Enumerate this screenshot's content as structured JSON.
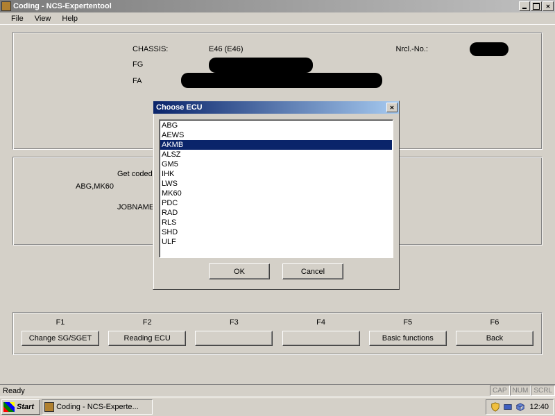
{
  "window": {
    "title": "Coding - NCS-Expertentool"
  },
  "menu": {
    "file": "File",
    "view": "View",
    "help": "Help"
  },
  "info": {
    "chassis_label": "CHASSIS:",
    "chassis_value": "E46 (E46)",
    "nrcl_label": "Nrcl.-No.:",
    "fg_label": "FG",
    "fa_label": "FA"
  },
  "coded": {
    "get_coded_label": "Get coded:",
    "coded_list": "ABG,MK60",
    "jobname_label": "JOBNAME"
  },
  "fkeys": {
    "f1": {
      "key": "F1",
      "label": "Change SG/SGET"
    },
    "f2": {
      "key": "F2",
      "label": "Reading ECU"
    },
    "f3": {
      "key": "F3",
      "label": ""
    },
    "f4": {
      "key": "F4",
      "label": ""
    },
    "f5": {
      "key": "F5",
      "label": "Basic functions"
    },
    "f6": {
      "key": "F6",
      "label": "Back"
    }
  },
  "status": {
    "ready": "Ready",
    "cap": "CAP",
    "num": "NUM",
    "scrl": "SCRL"
  },
  "taskbar": {
    "start": "Start",
    "task_title": "Coding - NCS-Experte...",
    "clock": "12:40"
  },
  "dialog": {
    "title": "Choose ECU",
    "ok": "OK",
    "cancel": "Cancel",
    "items": [
      "ABG",
      "AEWS",
      "AKMB",
      "ALSZ",
      "GM5",
      "IHK",
      "LWS",
      "MK60",
      "PDC",
      "RAD",
      "RLS",
      "SHD",
      "ULF"
    ],
    "selected_index": 2
  }
}
